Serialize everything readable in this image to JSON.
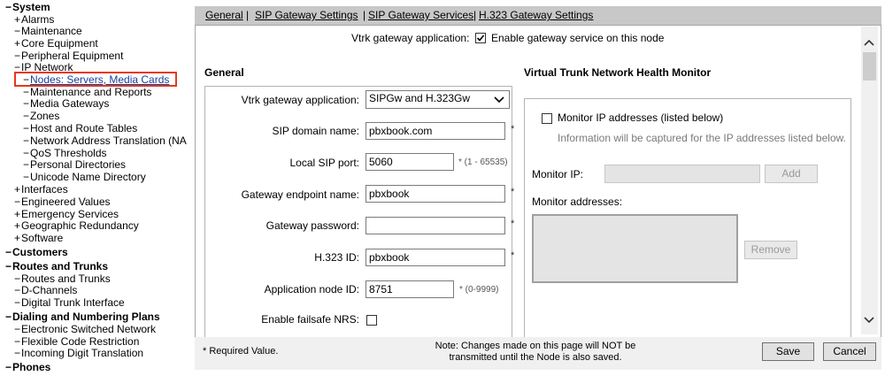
{
  "nav": {
    "items": [
      {
        "marker": "−",
        "label": "System",
        "bold": true
      },
      {
        "marker": "+",
        "label": "Alarms"
      },
      {
        "marker": "−",
        "label": "Maintenance"
      },
      {
        "marker": "+",
        "label": "Core Equipment"
      },
      {
        "marker": "−",
        "label": "Peripheral Equipment"
      },
      {
        "marker": "−",
        "label": "IP Network"
      },
      {
        "marker": "−",
        "label": "Nodes: Servers, Media Cards",
        "active": true
      },
      {
        "marker": "−",
        "label": "Maintenance and Reports"
      },
      {
        "marker": "−",
        "label": "Media Gateways"
      },
      {
        "marker": "−",
        "label": "Zones"
      },
      {
        "marker": "−",
        "label": "Host and Route Tables"
      },
      {
        "marker": "−",
        "label": "Network Address Translation (NA"
      },
      {
        "marker": "−",
        "label": "QoS Thresholds"
      },
      {
        "marker": "−",
        "label": "Personal Directories"
      },
      {
        "marker": "−",
        "label": "Unicode Name Directory"
      },
      {
        "marker": "+",
        "label": "Interfaces"
      },
      {
        "marker": "−",
        "label": "Engineered Values"
      },
      {
        "marker": "+",
        "label": "Emergency Services"
      },
      {
        "marker": "+",
        "label": "Geographic Redundancy"
      },
      {
        "marker": "+",
        "label": "Software"
      },
      {
        "marker": "−",
        "label": "Customers",
        "bold": true
      },
      {
        "marker": "−",
        "label": "Routes and Trunks",
        "bold": true
      },
      {
        "marker": "−",
        "label": "Routes and Trunks"
      },
      {
        "marker": "−",
        "label": "D-Channels"
      },
      {
        "marker": "−",
        "label": "Digital Trunk Interface"
      },
      {
        "marker": "−",
        "label": "Dialing and Numbering Plans",
        "bold": true
      },
      {
        "marker": "−",
        "label": "Electronic Switched Network"
      },
      {
        "marker": "−",
        "label": "Flexible Code Restriction"
      },
      {
        "marker": "−",
        "label": "Incoming Digit Translation"
      },
      {
        "marker": "−",
        "label": "Phones",
        "bold": true
      }
    ]
  },
  "tabs": {
    "general": "General",
    "sip_gateway_settings": "SIP Gateway Settings",
    "sip_gateway_services": "SIP Gateway Services",
    "h323_gateway_settings": "H.323 Gateway Settings",
    "separator": "|"
  },
  "top": {
    "label": "Vtrk gateway application:",
    "checkbox_label": "Enable gateway service on this node",
    "checked": true
  },
  "general": {
    "title": "General",
    "app_label": "Vtrk gateway application:",
    "app_value": "SIPGw and H.323Gw",
    "sip_domain_label": "SIP domain name:",
    "sip_domain_value": "pbxbook.com",
    "local_sip_port_label": "Local SIP port:",
    "local_sip_port_value": "5060",
    "local_sip_port_range": "* (1 - 65535)",
    "gateway_endpoint_label": "Gateway endpoint name:",
    "gateway_endpoint_value": "pbxbook",
    "gateway_password_label": "Gateway password:",
    "gateway_password_value": "",
    "h323_id_label": "H.323 ID:",
    "h323_id_value": "pbxbook",
    "app_node_id_label": "Application node ID:",
    "app_node_id_value": "8751",
    "app_node_id_range": "* (0-9999)",
    "failsafe_label": "Enable failsafe NRS:",
    "required_marker": "*"
  },
  "health": {
    "title": "Virtual Trunk Network Health Monitor",
    "monitor_checkbox_label": "Monitor IP addresses (listed below)",
    "info_text": "Information will be captured for the IP addresses listed below.",
    "monitor_ip_label": "Monitor IP:",
    "add_button": "Add",
    "monitor_addresses_label": "Monitor addresses:",
    "remove_button": "Remove"
  },
  "footer": {
    "required_note": "* Required Value.",
    "note_line1": "Note: Changes made on this page will NOT be",
    "note_line2": "transmitted until the Node is also saved.",
    "save_button": "Save",
    "cancel_button": "Cancel"
  }
}
